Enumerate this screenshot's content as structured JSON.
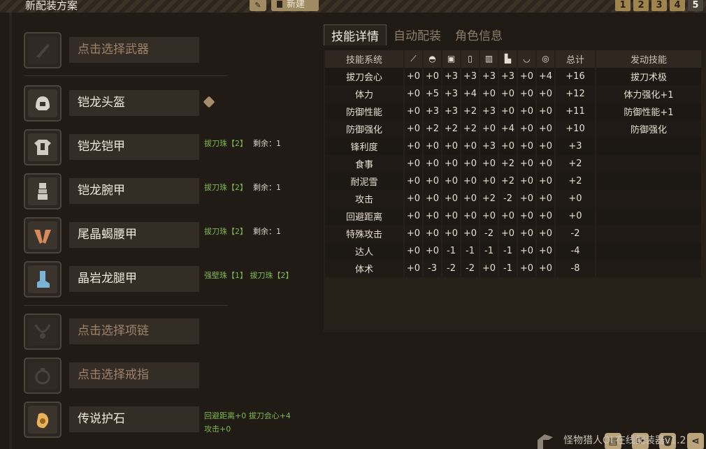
{
  "header": {
    "plan_title": "新配装方案",
    "new_label": "新建",
    "slots": [
      "1",
      "2",
      "3",
      "4",
      "5"
    ]
  },
  "equipment": {
    "weapon": {
      "name": "点击选择武器"
    },
    "helm": {
      "name": "铠龙头盔"
    },
    "chest": {
      "name": "铠龙铠甲",
      "jewels": "拔刀珠【2】",
      "rest": "剩余：1"
    },
    "arms": {
      "name": "铠龙腕甲",
      "jewels": "拔刀珠【2】",
      "rest": "剩余：1"
    },
    "waist": {
      "name": "尾晶蝎腰甲",
      "jewels": "拔刀珠【2】",
      "rest": "剩余：1"
    },
    "legs": {
      "name": "晶岩龙腿甲",
      "jewels": "强壁珠【1】  拔刀珠【2】"
    },
    "necklace": {
      "name": "点击选择项链"
    },
    "ring": {
      "name": "点击选择戒指"
    },
    "charm": {
      "name": "传说护石",
      "jewels": "回避距离+0  拔刀会心+4",
      "jewels2": "攻击+0"
    }
  },
  "tabs": [
    "技能详情",
    "自动配装",
    "角色信息"
  ],
  "table": {
    "headers": {
      "skill": "技能系统",
      "total": "总计",
      "active": "发动技能"
    },
    "header_icons": [
      "weapon-icon",
      "helm-icon",
      "chest-icon",
      "arms-icon",
      "waist-icon",
      "legs-icon",
      "necklace-icon",
      "ring-icon"
    ],
    "rows": [
      {
        "skill": "拔刀会心",
        "v": [
          "+0",
          "+0",
          "+3",
          "+3",
          "+3",
          "+3",
          "+0",
          "+4"
        ],
        "total": "+16",
        "active": "拔刀术极"
      },
      {
        "skill": "体力",
        "v": [
          "+0",
          "+5",
          "+3",
          "+4",
          "+0",
          "+0",
          "+0",
          "+0"
        ],
        "total": "+12",
        "active": "体力强化+1"
      },
      {
        "skill": "防御性能",
        "v": [
          "+0",
          "+3",
          "+3",
          "+2",
          "+3",
          "+0",
          "+0",
          "+0"
        ],
        "total": "+11",
        "active": "防御性能+1"
      },
      {
        "skill": "防御强化",
        "v": [
          "+0",
          "+2",
          "+2",
          "+2",
          "+0",
          "+4",
          "+0",
          "+0"
        ],
        "total": "+10",
        "active": "防御强化"
      },
      {
        "skill": "锋利度",
        "v": [
          "+0",
          "+0",
          "+0",
          "+0",
          "+3",
          "+0",
          "+0",
          "+0"
        ],
        "total": "+3",
        "active": ""
      },
      {
        "skill": "食事",
        "v": [
          "+0",
          "+0",
          "+0",
          "+0",
          "+0",
          "+2",
          "+0",
          "+0"
        ],
        "total": "+2",
        "active": ""
      },
      {
        "skill": "耐泥雪",
        "v": [
          "+0",
          "+0",
          "+0",
          "+0",
          "+0",
          "+2",
          "+0",
          "+0"
        ],
        "total": "+2",
        "active": ""
      },
      {
        "skill": "攻击",
        "v": [
          "+0",
          "+0",
          "+0",
          "+0",
          "+2",
          "-2",
          "+0",
          "+0"
        ],
        "total": "+0",
        "active": ""
      },
      {
        "skill": "回避距离",
        "v": [
          "+0",
          "+0",
          "+0",
          "+0",
          "+0",
          "+0",
          "+0",
          "+0"
        ],
        "total": "+0",
        "active": ""
      },
      {
        "skill": "特殊攻击",
        "v": [
          "+0",
          "+0",
          "+0",
          "+0",
          "-2",
          "+0",
          "+0",
          "+0"
        ],
        "total": "-2",
        "active": ""
      },
      {
        "skill": "达人",
        "v": [
          "+0",
          "+0",
          "-1",
          "-1",
          "-1",
          "-1",
          "+0",
          "+0"
        ],
        "total": "-4",
        "active": ""
      },
      {
        "skill": "体术",
        "v": [
          "+0",
          "-3",
          "-2",
          "-2",
          "+0",
          "-1",
          "+0",
          "+0"
        ],
        "total": "-8",
        "active": ""
      }
    ]
  },
  "footer": {
    "app_name": "怪物猎人OL在线配装器v1.2"
  }
}
